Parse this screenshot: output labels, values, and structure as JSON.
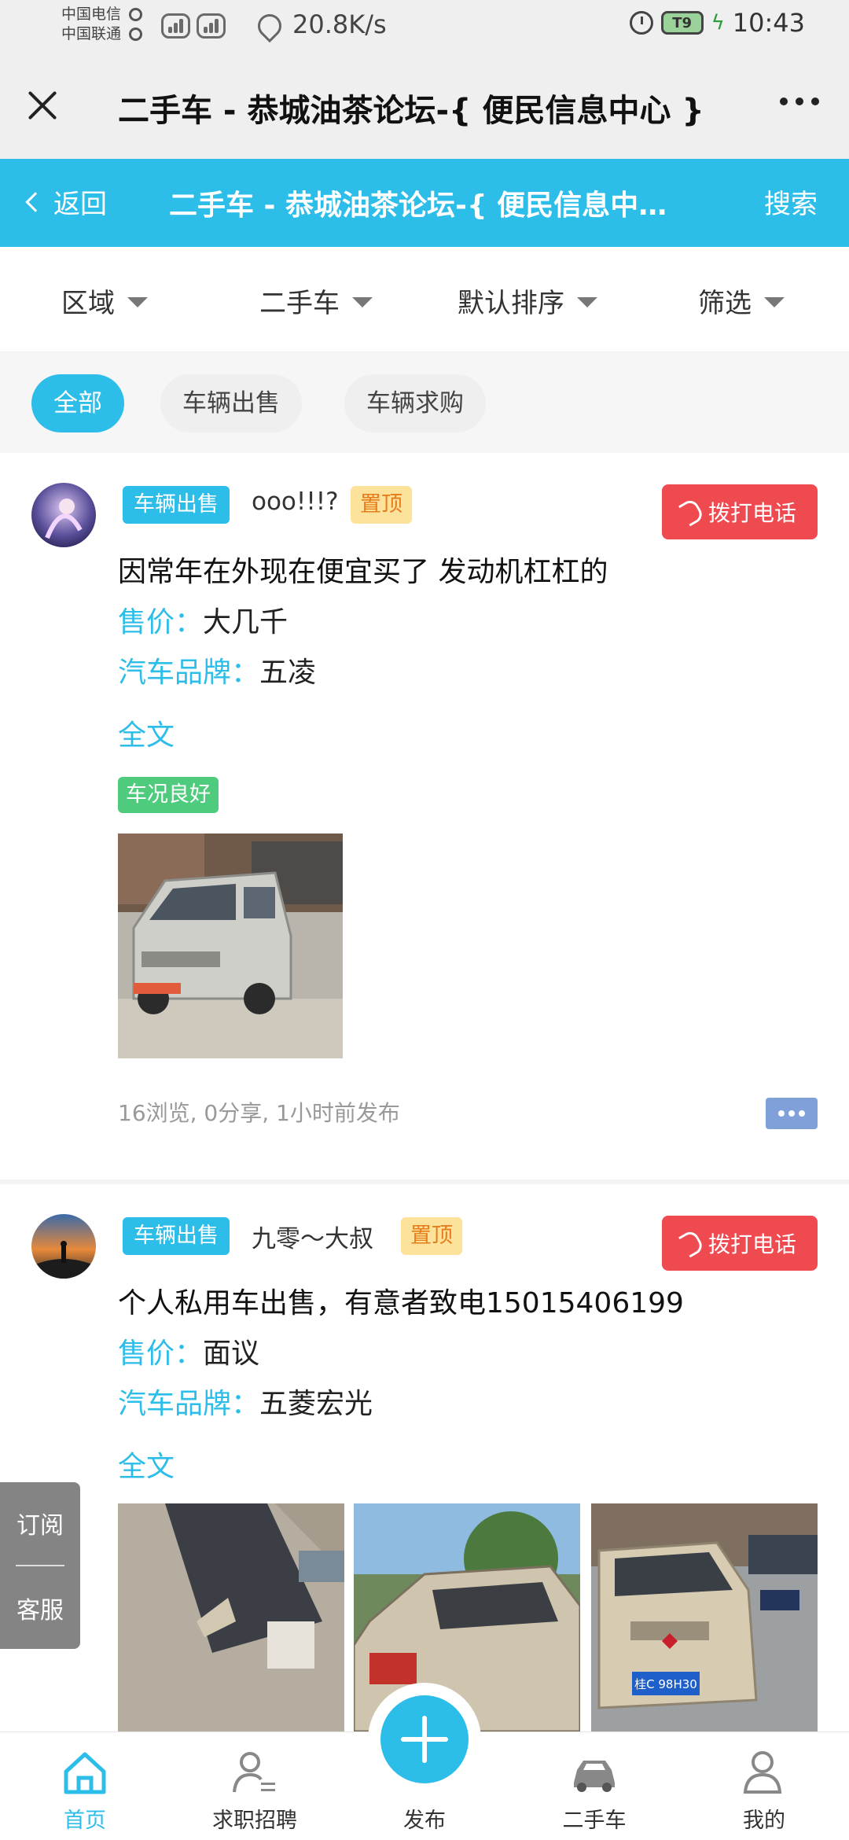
{
  "status_bar": {
    "carrier_1": "中国电信",
    "carrier_2": "中国联通",
    "net_speed": "20.8K/s",
    "battery": "T9",
    "time": "10:43"
  },
  "title_bar": {
    "title": "二手车 - 恭城油茶论坛-{ 便民信息中心 }",
    "close_icon": "close-icon",
    "more_icon": "more-dots-icon"
  },
  "header": {
    "back_label": "返回",
    "title": "二手车 - 恭城油茶论坛-{ 便民信息中心 }",
    "search_label": "搜索",
    "color": "#2dbde9"
  },
  "filters": [
    {
      "label": "区域"
    },
    {
      "label": "二手车"
    },
    {
      "label": "默认排序"
    },
    {
      "label": "筛选"
    }
  ],
  "chips": [
    {
      "label": "全部",
      "active": true
    },
    {
      "label": "车辆出售",
      "active": false
    },
    {
      "label": "车辆求购",
      "active": false
    }
  ],
  "posts": [
    {
      "tag": "车辆出售",
      "user": "ooo!!!?",
      "pin_tag": "置顶",
      "call_label": "拨打电话",
      "title": "因常年在外现在便宜买了 发动机杠杠的",
      "price_key": "售价：",
      "price_value": "大几千",
      "brand_key": "汽车品牌：",
      "brand_value": "五凌",
      "fulltext_label": "全文",
      "condition_tag": "车况良好",
      "stats": "16浏览, 0分享, 1小时前发布"
    },
    {
      "tag": "车辆出售",
      "user": "九零～大叔",
      "pin_tag": "置顶",
      "call_label": "拨打电话",
      "title": "个人私用车出售，有意者致电15015406199",
      "price_key": "售价：",
      "price_value": "面议",
      "brand_key": "汽车品牌：",
      "brand_value": "五菱宏光",
      "fulltext_label": "全文",
      "plate_text": "桂C 98H30"
    }
  ],
  "side_panel": {
    "subscribe": "订阅",
    "service": "客服"
  },
  "bottom_nav": [
    {
      "label": "首页",
      "icon": "home-icon",
      "active": true
    },
    {
      "label": "求职招聘",
      "icon": "person-list-icon",
      "active": false
    },
    {
      "label": "发布",
      "icon": "plus-icon",
      "active": false
    },
    {
      "label": "二手车",
      "icon": "car-icon",
      "active": false
    },
    {
      "label": "我的",
      "icon": "profile-icon",
      "active": false
    }
  ]
}
